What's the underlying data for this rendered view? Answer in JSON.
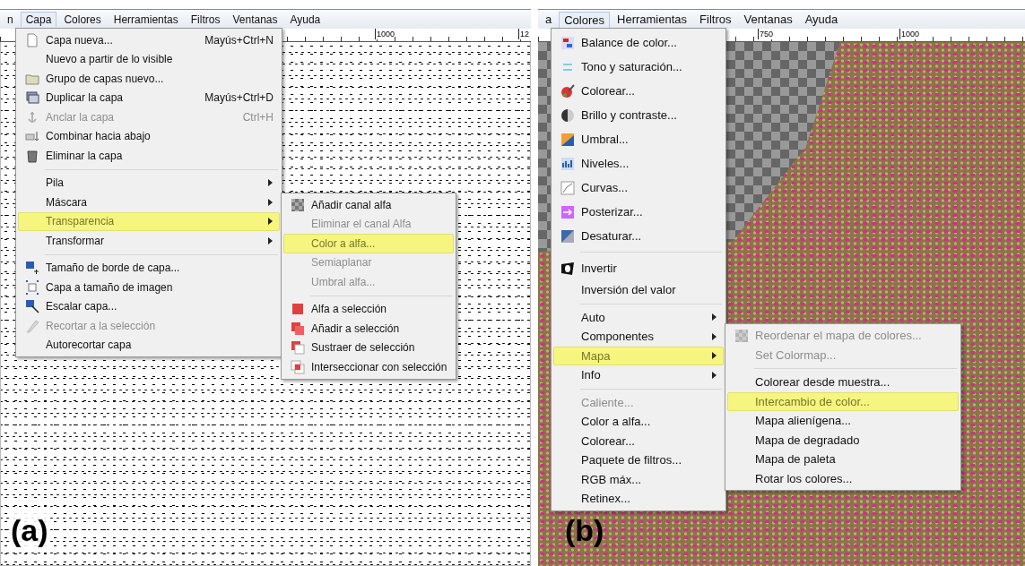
{
  "panels": [
    {
      "label": "(a)",
      "menubar": [
        {
          "label": "n",
          "selected": false
        },
        {
          "label": "Capa",
          "selected": true
        },
        {
          "label": "Colores",
          "selected": false
        },
        {
          "label": "Herramientas",
          "selected": false
        },
        {
          "label": "Filtros",
          "selected": false
        },
        {
          "label": "Ventanas",
          "selected": false
        },
        {
          "label": "Ayuda",
          "selected": false
        }
      ],
      "ruler": [
        "1000",
        "12"
      ],
      "menu": [
        {
          "kind": "item",
          "label": "Capa nueva...",
          "shortcut": "Mayús+Ctrl+N",
          "disabled": false,
          "selected": false,
          "has_submenu": false
        },
        {
          "kind": "item",
          "label": "Nuevo a partir de lo visible",
          "disabled": false,
          "selected": false,
          "has_submenu": false
        },
        {
          "kind": "item",
          "label": "Grupo de capas nuevo...",
          "disabled": false,
          "selected": false,
          "has_submenu": false
        },
        {
          "kind": "item",
          "label": "Duplicar la capa",
          "shortcut": "Mayús+Ctrl+D",
          "disabled": false,
          "selected": false,
          "has_submenu": false
        },
        {
          "kind": "item",
          "label": "Anclar la capa",
          "shortcut": "Ctrl+H",
          "disabled": true,
          "selected": false,
          "has_submenu": false
        },
        {
          "kind": "item",
          "label": "Combinar hacia abajo",
          "disabled": false,
          "selected": false,
          "has_submenu": false
        },
        {
          "kind": "item",
          "label": "Eliminar la capa",
          "disabled": false,
          "selected": false,
          "has_submenu": false
        },
        {
          "kind": "separator"
        },
        {
          "kind": "item",
          "label": "Pila",
          "disabled": false,
          "selected": false,
          "has_submenu": true
        },
        {
          "kind": "item",
          "label": "Máscara",
          "disabled": false,
          "selected": false,
          "has_submenu": true
        },
        {
          "kind": "item",
          "label": "Transparencia",
          "disabled": false,
          "selected": true,
          "has_submenu": true
        },
        {
          "kind": "item",
          "label": "Transformar",
          "disabled": false,
          "selected": false,
          "has_submenu": true
        },
        {
          "kind": "separator"
        },
        {
          "kind": "item",
          "label": "Tamaño de borde de capa...",
          "disabled": false,
          "selected": false,
          "has_submenu": false
        },
        {
          "kind": "item",
          "label": "Capa a tamaño de imagen",
          "disabled": false,
          "selected": false,
          "has_submenu": false
        },
        {
          "kind": "item",
          "label": "Escalar capa...",
          "disabled": false,
          "selected": false,
          "has_submenu": false
        },
        {
          "kind": "item",
          "label": "Recortar a la selección",
          "disabled": true,
          "selected": false,
          "has_submenu": false
        },
        {
          "kind": "item",
          "label": "Autorecortar capa",
          "disabled": false,
          "selected": false,
          "has_submenu": false
        }
      ],
      "submenu": [
        {
          "kind": "item",
          "label": "Añadir canal alfa",
          "disabled": false,
          "selected": false,
          "has_submenu": false
        },
        {
          "kind": "item",
          "label": "Eliminar el canal Alfa",
          "disabled": true,
          "selected": false,
          "has_submenu": false
        },
        {
          "kind": "item",
          "label": "Color a alfa...",
          "disabled": false,
          "selected": true,
          "has_submenu": false
        },
        {
          "kind": "item",
          "label": "Semiaplanar",
          "disabled": true,
          "selected": false,
          "has_submenu": false
        },
        {
          "kind": "item",
          "label": "Umbral alfa...",
          "disabled": true,
          "selected": false,
          "has_submenu": false
        },
        {
          "kind": "separator"
        },
        {
          "kind": "item",
          "label": "Alfa a selección",
          "disabled": false,
          "selected": false,
          "has_submenu": false
        },
        {
          "kind": "item",
          "label": "Añadir a selección",
          "disabled": false,
          "selected": false,
          "has_submenu": false
        },
        {
          "kind": "item",
          "label": "Sustraer de selección",
          "disabled": false,
          "selected": false,
          "has_submenu": false
        },
        {
          "kind": "item",
          "label": "Interseccionar con selección",
          "disabled": false,
          "selected": false,
          "has_submenu": false
        }
      ]
    },
    {
      "label": "(b)",
      "menubar": [
        {
          "label": "a",
          "selected": false
        },
        {
          "label": "Colores",
          "selected": true
        },
        {
          "label": "Herramientas",
          "selected": false
        },
        {
          "label": "Filtros",
          "selected": false
        },
        {
          "label": "Ventanas",
          "selected": false
        },
        {
          "label": "Ayuda",
          "selected": false
        }
      ],
      "ruler": [
        "750",
        "1000"
      ],
      "menu": [
        {
          "kind": "item",
          "label": "Balance de color...",
          "disabled": false,
          "selected": false,
          "has_submenu": false
        },
        {
          "kind": "item",
          "label": "Tono y saturación...",
          "disabled": false,
          "selected": false,
          "has_submenu": false
        },
        {
          "kind": "item",
          "label": "Colorear...",
          "disabled": false,
          "selected": false,
          "has_submenu": false
        },
        {
          "kind": "item",
          "label": "Brillo y contraste...",
          "disabled": false,
          "selected": false,
          "has_submenu": false
        },
        {
          "kind": "item",
          "label": "Umbral...",
          "disabled": false,
          "selected": false,
          "has_submenu": false
        },
        {
          "kind": "item",
          "label": "Niveles...",
          "disabled": false,
          "selected": false,
          "has_submenu": false
        },
        {
          "kind": "item",
          "label": "Curvas...",
          "disabled": false,
          "selected": false,
          "has_submenu": false
        },
        {
          "kind": "item",
          "label": "Posterizar...",
          "disabled": false,
          "selected": false,
          "has_submenu": false
        },
        {
          "kind": "item",
          "label": "Desaturar...",
          "disabled": false,
          "selected": false,
          "has_submenu": false
        },
        {
          "kind": "separator"
        },
        {
          "kind": "item",
          "label": "Invertir",
          "disabled": false,
          "selected": false,
          "has_submenu": false
        },
        {
          "kind": "item",
          "label": "Inversión del valor",
          "disabled": false,
          "selected": false,
          "has_submenu": false
        },
        {
          "kind": "separator"
        },
        {
          "kind": "item",
          "label": "Auto",
          "disabled": false,
          "selected": false,
          "has_submenu": true
        },
        {
          "kind": "item",
          "label": "Componentes",
          "disabled": false,
          "selected": false,
          "has_submenu": true
        },
        {
          "kind": "item",
          "label": "Mapa",
          "disabled": false,
          "selected": true,
          "has_submenu": true
        },
        {
          "kind": "item",
          "label": "Info",
          "disabled": false,
          "selected": false,
          "has_submenu": true
        },
        {
          "kind": "separator"
        },
        {
          "kind": "item",
          "label": "Caliente...",
          "disabled": true,
          "selected": false,
          "has_submenu": false
        },
        {
          "kind": "item",
          "label": "Color a alfa...",
          "disabled": false,
          "selected": false,
          "has_submenu": false
        },
        {
          "kind": "item",
          "label": "Colorear...",
          "disabled": false,
          "selected": false,
          "has_submenu": false
        },
        {
          "kind": "item",
          "label": "Paquete de filtros...",
          "disabled": false,
          "selected": false,
          "has_submenu": false
        },
        {
          "kind": "item",
          "label": "RGB máx...",
          "disabled": false,
          "selected": false,
          "has_submenu": false
        },
        {
          "kind": "item",
          "label": "Retinex...",
          "disabled": false,
          "selected": false,
          "has_submenu": false
        }
      ],
      "submenu": [
        {
          "kind": "item",
          "label": "Reordenar el mapa de colores...",
          "disabled": true,
          "selected": false,
          "has_submenu": false
        },
        {
          "kind": "item",
          "label": "Set Colormap...",
          "disabled": true,
          "selected": false,
          "has_submenu": false
        },
        {
          "kind": "separator"
        },
        {
          "kind": "item",
          "label": "Colorear desde muestra...",
          "disabled": false,
          "selected": false,
          "has_submenu": false
        },
        {
          "kind": "item",
          "label": "Intercambio de color...",
          "disabled": false,
          "selected": true,
          "has_submenu": false
        },
        {
          "kind": "item",
          "label": "Mapa alienígena...",
          "disabled": false,
          "selected": false,
          "has_submenu": false
        },
        {
          "kind": "item",
          "label": "Mapa de degradado",
          "disabled": false,
          "selected": false,
          "has_submenu": false
        },
        {
          "kind": "item",
          "label": "Mapa de paleta",
          "disabled": false,
          "selected": false,
          "has_submenu": false
        },
        {
          "kind": "item",
          "label": "Rotar los colores...",
          "disabled": false,
          "selected": false,
          "has_submenu": false
        }
      ]
    }
  ]
}
